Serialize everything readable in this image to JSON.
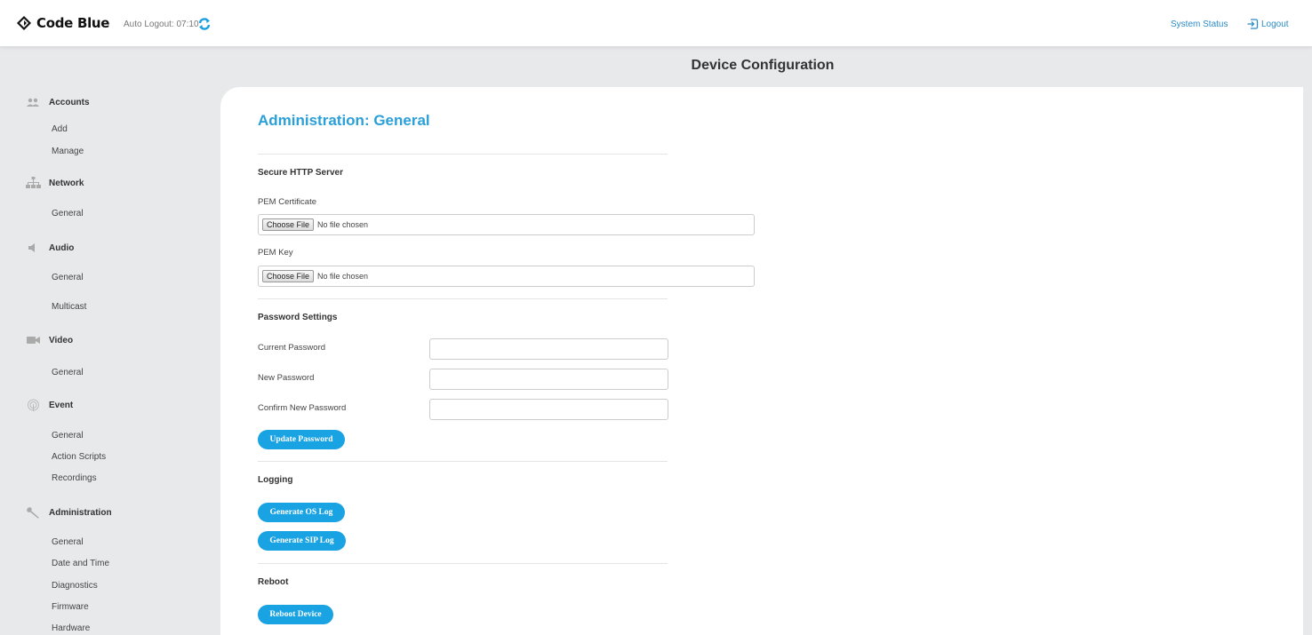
{
  "app": {
    "logo_text": "Code Blue",
    "auto_logout": "Auto Logout: 07:10",
    "system_status": "System Status",
    "logout": "Logout"
  },
  "page_title": "Device Configuration",
  "sidebar": {
    "sections": [
      {
        "label": "Accounts",
        "icon": "accounts-icon",
        "items": [
          "Add",
          "Manage"
        ]
      },
      {
        "label": "Network",
        "icon": "network-icon",
        "items": [
          "General"
        ]
      },
      {
        "label": "Audio",
        "icon": "audio-icon",
        "items": [
          "General",
          "Multicast"
        ]
      },
      {
        "label": "Video",
        "icon": "video-icon",
        "items": [
          "General"
        ]
      },
      {
        "label": "Event",
        "icon": "event-icon",
        "items": [
          "General",
          "Action Scripts",
          "Recordings"
        ]
      },
      {
        "label": "Administration",
        "icon": "wrench-icon",
        "items": [
          "General",
          "Date and Time",
          "Diagnostics",
          "Firmware",
          "Hardware"
        ]
      }
    ]
  },
  "main": {
    "title": "Administration: General",
    "https": {
      "section_title": "Secure HTTP Server",
      "pem_cert_label": "PEM Certificate",
      "pem_key_label": "PEM Key",
      "choose_file": "Choose File",
      "no_file": "No file chosen"
    },
    "password": {
      "section_title": "Password Settings",
      "current_label": "Current Password",
      "new_label": "New Password",
      "confirm_label": "Confirm New Password",
      "current_value": "",
      "new_value": "",
      "confirm_value": "",
      "update_button": "Update Password"
    },
    "logging": {
      "section_title": "Logging",
      "os_log_button": "Generate OS Log",
      "sip_log_button": "Generate SIP Log"
    },
    "reboot": {
      "section_title": "Reboot",
      "reboot_button": "Reboot Device"
    }
  },
  "colors": {
    "accent": "#19a3e3",
    "title_blue": "#2a9fd8",
    "sidebar_bg": "#e8e9eb"
  }
}
